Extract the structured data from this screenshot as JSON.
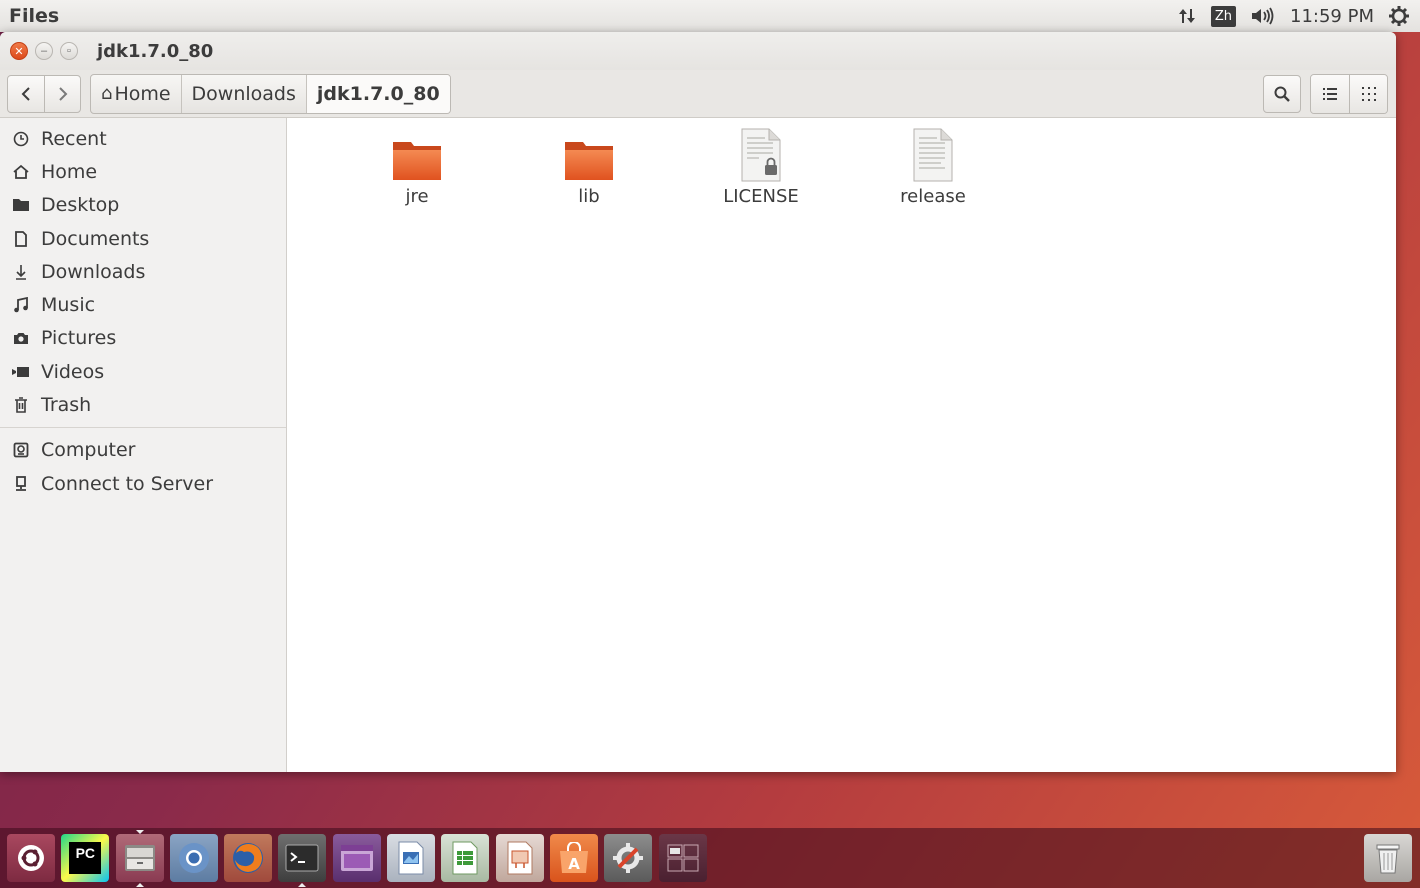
{
  "top_panel": {
    "app_title": "Files",
    "input_indicator": "Zh",
    "clock": "11:59 PM"
  },
  "window": {
    "title": "jdk1.7.0_80"
  },
  "toolbar": {
    "breadcrumbs": [
      "Home",
      "Downloads",
      "jdk1.7.0_80"
    ]
  },
  "sidebar": {
    "places": [
      {
        "label": "Recent",
        "icon": "clock-icon"
      },
      {
        "label": "Home",
        "icon": "home-icon"
      },
      {
        "label": "Desktop",
        "icon": "folder-icon"
      },
      {
        "label": "Documents",
        "icon": "document-icon"
      },
      {
        "label": "Downloads",
        "icon": "download-icon"
      },
      {
        "label": "Music",
        "icon": "music-icon"
      },
      {
        "label": "Pictures",
        "icon": "camera-icon"
      },
      {
        "label": "Videos",
        "icon": "video-icon"
      },
      {
        "label": "Trash",
        "icon": "trash-icon"
      }
    ],
    "devices": [
      {
        "label": "Computer",
        "icon": "computer-icon"
      },
      {
        "label": "Connect to Server",
        "icon": "server-icon"
      }
    ]
  },
  "files": [
    {
      "name": "jre",
      "type": "folder"
    },
    {
      "name": "lib",
      "type": "folder"
    },
    {
      "name": "LICENSE",
      "type": "locked-text-file"
    },
    {
      "name": "release",
      "type": "text-file"
    }
  ],
  "launcher": {
    "apps": [
      "ubuntu-dash",
      "pycharm",
      "files",
      "chromium",
      "firefox",
      "terminal",
      "app-window",
      "writer",
      "calc",
      "impress",
      "software-center",
      "system-settings",
      "workspace-switcher"
    ]
  },
  "colors": {
    "accent_orange": "#e4582a",
    "sidebar_bg": "#f2f1f0",
    "panel_bg": "#e9e7e4"
  }
}
